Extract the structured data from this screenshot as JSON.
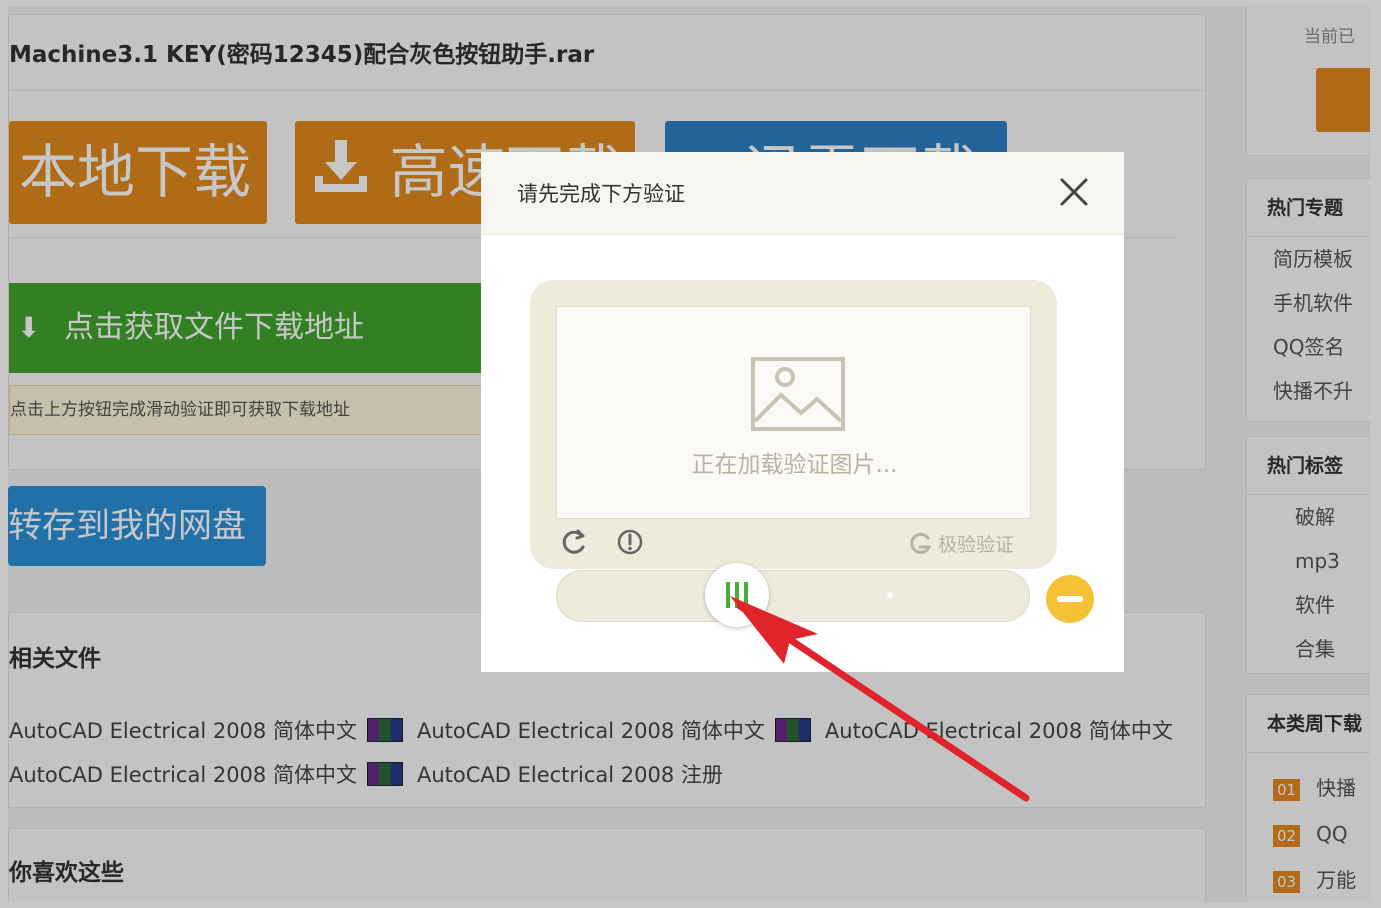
{
  "download": {
    "filename": "Machine3.1 KEY(密码12345)配合灰色按钮助手.rar",
    "local_download": "本地下载",
    "fast_download": "高速下载",
    "xunlei_download": "迅雷下载",
    "get_link": "点击获取文件下载地址",
    "hint": "点击上方按钮完成滑动验证即可获取下载地址",
    "save_to_disk": "转存到我的网盘"
  },
  "related": {
    "heading": "相关文件",
    "files": [
      "AutoCAD Electrical 2008 简体中文",
      "AutoCAD Electrical 2008 简体中文",
      "AutoCAD Electrical 2008 简体中文",
      "AutoCAD Electrical 2008 简体中文",
      "AutoCAD Electrical 2008 注册"
    ]
  },
  "also_like": {
    "heading": "你喜欢这些"
  },
  "sidebar": {
    "current": "当前已",
    "hot_topics": {
      "title": "热门专题",
      "items": [
        "简历模板",
        "手机软件",
        "QQ签名",
        "快播不升"
      ]
    },
    "hot_tags": {
      "title": "热门标签",
      "items": [
        "破解",
        "mp3",
        "软件",
        "合集"
      ]
    },
    "weekly": {
      "title": "本类周下载",
      "items": [
        {
          "rank": "01",
          "label": "快播"
        },
        {
          "rank": "02",
          "label": "QQ"
        },
        {
          "rank": "03",
          "label": "万能"
        }
      ]
    }
  },
  "captcha": {
    "title": "请先完成下方验证",
    "loading": "正在加载验证图片...",
    "brand": "极验验证"
  },
  "colors": {
    "orange": "#e28a1d",
    "green": "#41a52e",
    "blue": "#2c90d8",
    "slider_green": "#4caf35",
    "status_yellow": "#f5c136",
    "arrow_red": "#e0242b"
  }
}
